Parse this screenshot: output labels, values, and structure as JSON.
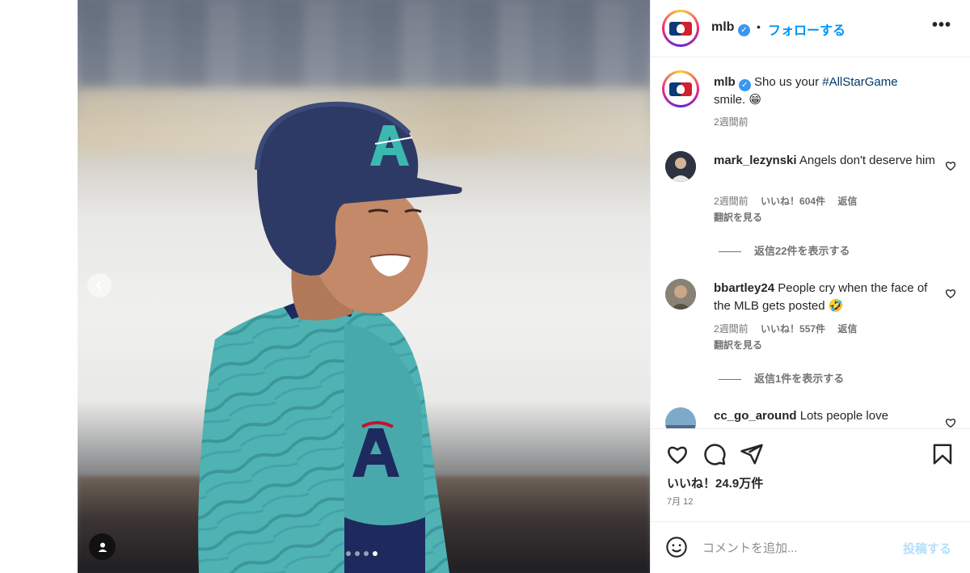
{
  "header": {
    "username": "mlb",
    "separator": "•",
    "follow_label": "フォローする",
    "more_label": "•••"
  },
  "media": {
    "slide_count": 4,
    "active_slide": 4
  },
  "caption": {
    "username": "mlb",
    "text_before": "Sho us your ",
    "hashtag": "#AllStarGame",
    "text_after": "smile. 😁",
    "time": "2週間前"
  },
  "comments": [
    {
      "username": "mark_lezynski",
      "text": "Angels don't deserve him",
      "time": "2週間前",
      "likes": "いいね！604件",
      "reply_label": "返信",
      "translate_label": "翻訳を見る",
      "replies_label": "返信22件を表示する"
    },
    {
      "username": "bbartley24",
      "text": "People cry when the face of the MLB gets posted 🤣",
      "time": "2週間前",
      "likes": "いいね！557件",
      "reply_label": "返信",
      "translate_label": "翻訳を見る",
      "replies_label": "返信1件を表示する"
    },
    {
      "username": "cc_go_around",
      "text": "Lots people love"
    }
  ],
  "actions": {
    "likes_label": "いいね！24.9万件",
    "date": "7月 12"
  },
  "composer": {
    "placeholder": "コメントを追加...",
    "post_label": "投稿する"
  },
  "icons": {
    "like": "heart-icon",
    "comment": "comment-icon",
    "share": "send-icon",
    "save": "bookmark-icon",
    "emoji": "emoji-icon",
    "prev": "chevron-left-icon",
    "tag": "user-tag-icon"
  },
  "colors": {
    "accent": "#0095f6",
    "hashtag": "#00376b",
    "muted": "#737373",
    "verified": "#3897f0",
    "post_disabled": "#b2dffc"
  }
}
